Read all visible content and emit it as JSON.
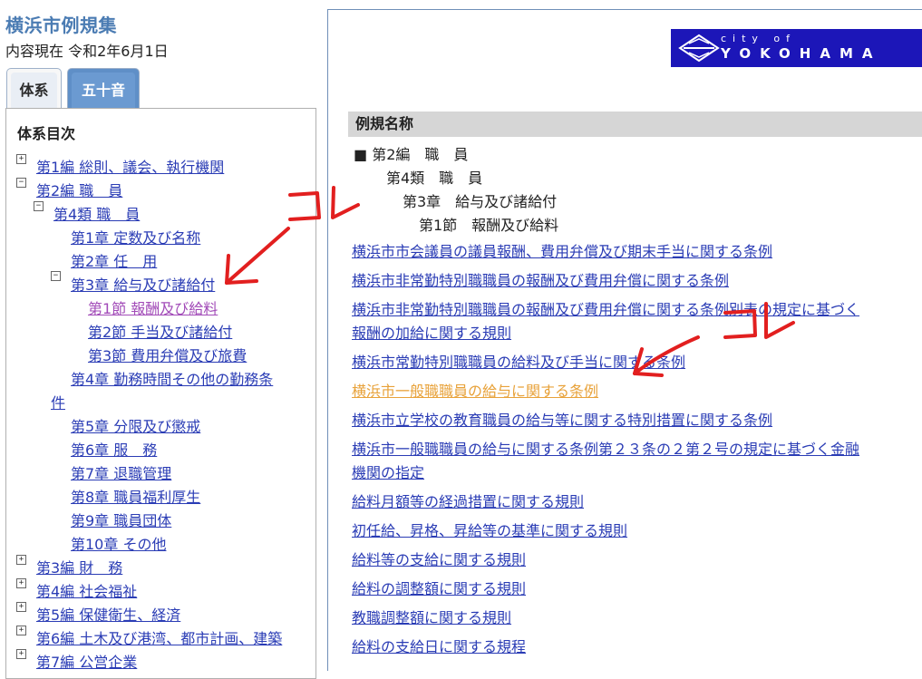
{
  "app": {
    "title": "横浜市例規集",
    "updated": "内容現在 令和2年6月1日"
  },
  "tabs": [
    {
      "label": "体系"
    },
    {
      "label": "五十音"
    }
  ],
  "tree": {
    "heading": "体系目次",
    "items": [
      {
        "toggle": "+",
        "label": "第1編 総則、議会、執行機関"
      },
      {
        "toggle": "−",
        "label": "第2編 職　員"
      },
      {
        "toggle": "−",
        "label": "第4類 職　員"
      },
      {
        "toggle": "",
        "label": "第1章 定数及び名称"
      },
      {
        "toggle": "",
        "label": "第2章 任　用"
      },
      {
        "toggle": "−",
        "label": "第3章 給与及び諸給付"
      },
      {
        "toggle": "",
        "label": "第1節 報酬及び給料"
      },
      {
        "toggle": "",
        "label": "第2節 手当及び諸給付"
      },
      {
        "toggle": "",
        "label": "第3節 費用弁償及び旅費"
      },
      {
        "toggle": "",
        "label": "第4章 勤務時間その他の勤務条"
      },
      {
        "toggle": "",
        "label": "件"
      },
      {
        "toggle": "",
        "label": "第5章 分限及び懲戒"
      },
      {
        "toggle": "",
        "label": "第6章 服　務"
      },
      {
        "toggle": "",
        "label": "第7章 退職管理"
      },
      {
        "toggle": "",
        "label": "第8章 職員福利厚生"
      },
      {
        "toggle": "",
        "label": "第9章 職員団体"
      },
      {
        "toggle": "",
        "label": "第10章 その他"
      },
      {
        "toggle": "+",
        "label": "第3編 財　務"
      },
      {
        "toggle": "+",
        "label": "第4編 社会福祉"
      },
      {
        "toggle": "+",
        "label": "第5編 保健衛生、経済"
      },
      {
        "toggle": "+",
        "label": "第6編 土木及び港湾、都市計画、建築"
      },
      {
        "toggle": "+",
        "label": "第7編 公営企業"
      }
    ]
  },
  "logo": {
    "city_of": "city of",
    "name": "YOKOHAMA",
    "color": "#1c16b8"
  },
  "content": {
    "header": "例規名称",
    "context": [
      "■ 第2編　職　員",
      "第4類　職　員",
      "第3章　給与及び諸給付",
      "第1節　報酬及び給料"
    ],
    "links": [
      "横浜市市会議員の議員報酬、費用弁償及び期末手当に関する条例",
      "横浜市非常勤特別職職員の報酬及び費用弁償に関する条例",
      "横浜市非常勤特別職職員の報酬及び費用弁償に関する条例別表の規定に基づく",
      "報酬の加給に関する規則",
      "横浜市常勤特別職職員の給料及び手当に関する条例",
      "横浜市一般職職員の給与に関する条例",
      "横浜市立学校の教育職員の給与等に関する特別措置に関する条例",
      "横浜市一般職職員の給与に関する条例第２３条の２第２号の規定に基づく金融",
      "機関の指定",
      "給料月額等の経過措置に関する規則",
      "初任給、昇格、昇給等の基準に関する規則",
      "給料等の支給に関する規則",
      "給料の調整額に関する規則",
      "教職調整額に関する規則",
      "給料の支給日に関する規程"
    ]
  },
  "annotations": {
    "label_left": "コレ",
    "label_right": "コレ",
    "color": "#e21f1f"
  },
  "colors": {
    "link": "#2a3cb5",
    "visited": "#a24bb8",
    "highlight": "#e8a23a",
    "title": "#4b7cb3"
  }
}
